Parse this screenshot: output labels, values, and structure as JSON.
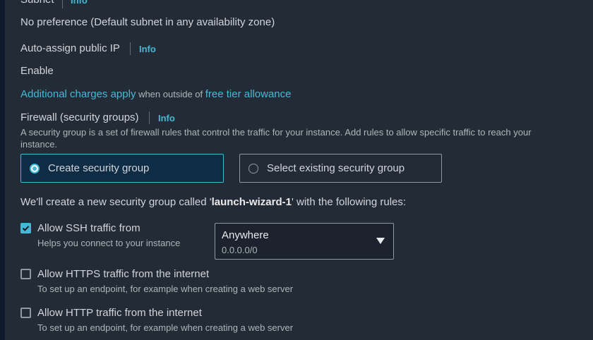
{
  "subnet": {
    "label": "Subnet",
    "info": "Info",
    "value": "No preference (Default subnet in any availability zone)"
  },
  "public_ip": {
    "label": "Auto-assign public IP",
    "info": "Info",
    "value": "Enable"
  },
  "charges": {
    "link1": "Additional charges apply",
    "middle": " when outside of ",
    "link2": "free tier allowance"
  },
  "firewall": {
    "label": "Firewall (security groups)",
    "info": "Info",
    "description": "A security group is a set of firewall rules that control the traffic for your instance. Add rules to allow specific traffic to reach your instance.",
    "option_create": "Create security group",
    "option_existing": "Select existing security group"
  },
  "new_group": {
    "prefix": "We'll create a new security group called '",
    "name": "launch-wizard-1",
    "suffix": "' with the following rules:"
  },
  "rules": {
    "ssh": {
      "label": "Allow SSH traffic from",
      "help": "Helps you connect to your instance",
      "checked": true
    },
    "https": {
      "label": "Allow HTTPS traffic from the internet",
      "help": "To set up an endpoint, for example when creating a web server",
      "checked": false
    },
    "http": {
      "label": "Allow HTTP traffic from the internet",
      "help": "To set up an endpoint, for example when creating a web server",
      "checked": false
    }
  },
  "ssh_source": {
    "selected": "Anywhere",
    "cidr": "0.0.0.0/0"
  },
  "colors": {
    "accent": "#44b9d6",
    "panel": "#232b37",
    "selected_tile": "#0f2c45"
  }
}
